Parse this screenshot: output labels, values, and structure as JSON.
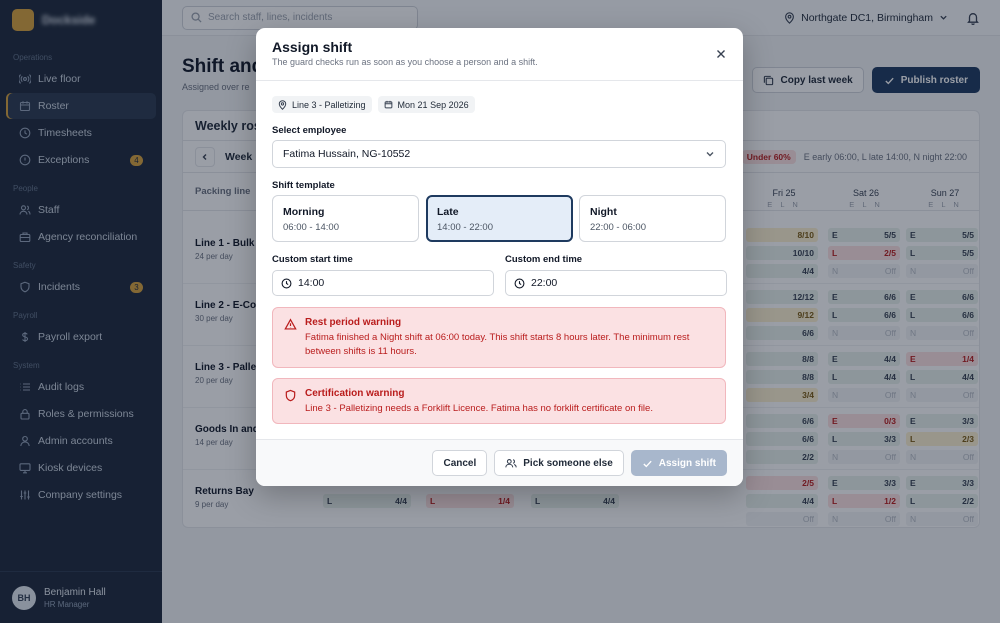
{
  "app": {
    "brand": "Dockside"
  },
  "sidebar": {
    "sections": [
      {
        "title": "Operations",
        "items": [
          {
            "label": "Live floor",
            "icon": "broadcast-icon"
          },
          {
            "label": "Roster",
            "icon": "calendar-icon",
            "active": true
          },
          {
            "label": "Timesheets",
            "icon": "clock-icon"
          },
          {
            "label": "Exceptions",
            "icon": "alert-circle-icon",
            "badge": "4"
          }
        ]
      },
      {
        "title": "People",
        "items": [
          {
            "label": "Staff",
            "icon": "users-icon"
          },
          {
            "label": "Agency reconciliation",
            "icon": "briefcase-icon"
          }
        ]
      },
      {
        "title": "Safety",
        "items": [
          {
            "label": "Incidents",
            "icon": "shield-icon",
            "badge": "3"
          }
        ]
      },
      {
        "title": "Payroll",
        "items": [
          {
            "label": "Payroll export",
            "icon": "dollar-icon"
          }
        ]
      },
      {
        "title": "System",
        "items": [
          {
            "label": "Audit logs",
            "icon": "list-icon"
          },
          {
            "label": "Roles & permissions",
            "icon": "lock-icon"
          },
          {
            "label": "Admin accounts",
            "icon": "user-icon"
          },
          {
            "label": "Kiosk devices",
            "icon": "monitor-icon"
          },
          {
            "label": "Company settings",
            "icon": "sliders-icon"
          }
        ]
      }
    ],
    "user": {
      "initials": "BH",
      "name": "Benjamin Hall",
      "role": "HR Manager"
    }
  },
  "topbar": {
    "search_placeholder": "Search staff, lines, incidents",
    "location": "Northgate DC1, Birmingham"
  },
  "page": {
    "title": "Shift and",
    "subtitle": "Assigned over re",
    "copy_label": "Copy last week",
    "publish_label": "Publish roster",
    "card_title": "Weekly ros",
    "week_label": "Week",
    "under_badge": "Under 60%",
    "legend_text": "E early 06:00, L late 14:00, N night 22:00",
    "line_header": "Packing line",
    "days": [
      {
        "name": "Fri 25",
        "sub": "E L N"
      },
      {
        "name": "Sat 26",
        "sub": "E L N"
      },
      {
        "name": "Sun 27",
        "sub": "E L N"
      }
    ],
    "lines": [
      {
        "name": "Line 1 - Bulk P",
        "sub": "24 per day",
        "rows": [
          [
            {
              "k": "",
              "v": "8/10",
              "s": "warn"
            },
            {
              "k": "E",
              "v": "5/5",
              "s": "ok"
            },
            {
              "k": "E",
              "v": "5/5",
              "s": "ok"
            }
          ],
          [
            {
              "k": "",
              "v": "10/10",
              "s": "ok"
            },
            {
              "k": "L",
              "v": "2/5",
              "s": "bad"
            },
            {
              "k": "L",
              "v": "5/5",
              "s": "ok"
            }
          ],
          [
            {
              "k": "",
              "v": "4/4",
              "s": "ok"
            },
            {
              "k": "N",
              "v": "Off",
              "s": "off"
            },
            {
              "k": "N",
              "v": "Off",
              "s": "off"
            }
          ]
        ]
      },
      {
        "name": "Line 2 - E-Con",
        "sub": "30 per day",
        "rows": [
          [
            {
              "k": "",
              "v": "12/12",
              "s": "ok"
            },
            {
              "k": "E",
              "v": "6/6",
              "s": "ok"
            },
            {
              "k": "E",
              "v": "6/6",
              "s": "ok"
            }
          ],
          [
            {
              "k": "",
              "v": "9/12",
              "s": "warn"
            },
            {
              "k": "L",
              "v": "6/6",
              "s": "ok"
            },
            {
              "k": "L",
              "v": "6/6",
              "s": "ok"
            }
          ],
          [
            {
              "k": "",
              "v": "6/6",
              "s": "ok"
            },
            {
              "k": "N",
              "v": "Off",
              "s": "off"
            },
            {
              "k": "N",
              "v": "Off",
              "s": "off"
            }
          ]
        ]
      },
      {
        "name": "Line 3 - Pallet",
        "sub": "20 per day",
        "rows": [
          [
            {
              "k": "",
              "v": "8/8",
              "s": "ok"
            },
            {
              "k": "E",
              "v": "4/4",
              "s": "ok"
            },
            {
              "k": "E",
              "v": "1/4",
              "s": "bad"
            }
          ],
          [
            {
              "k": "",
              "v": "8/8",
              "s": "ok"
            },
            {
              "k": "L",
              "v": "4/4",
              "s": "ok"
            },
            {
              "k": "L",
              "v": "4/4",
              "s": "ok"
            }
          ],
          [
            {
              "k": "",
              "v": "3/4",
              "s": "warn"
            },
            {
              "k": "N",
              "v": "Off",
              "s": "off"
            },
            {
              "k": "N",
              "v": "Off",
              "s": "off"
            }
          ]
        ]
      },
      {
        "name": "Goods In and",
        "sub": "14 per day",
        "rows": [
          [
            {
              "k": "",
              "v": "6/6",
              "s": "ok"
            },
            {
              "k": "E",
              "v": "0/3",
              "s": "bad"
            },
            {
              "k": "E",
              "v": "3/3",
              "s": "ok"
            }
          ],
          [
            {
              "k": "",
              "v": "6/6",
              "s": "ok"
            },
            {
              "k": "L",
              "v": "3/3",
              "s": "ok"
            },
            {
              "k": "L",
              "v": "2/3",
              "s": "warn"
            }
          ],
          [
            {
              "k": "",
              "v": "2/2",
              "s": "ok"
            },
            {
              "k": "N",
              "v": "Off",
              "s": "off"
            },
            {
              "k": "N",
              "v": "Off",
              "s": "off"
            }
          ]
        ]
      },
      {
        "name": "Returns Bay",
        "sub": "9 per day",
        "rows": [
          [
            {
              "k": "",
              "v": "2/5",
              "s": "bad"
            },
            {
              "k": "E",
              "v": "3/3",
              "s": "ok"
            },
            {
              "k": "E",
              "v": "3/3",
              "s": "ok"
            }
          ],
          [
            {
              "k": "",
              "v": "4/4",
              "s": "ok"
            },
            {
              "k": "L",
              "v": "1/2",
              "s": "bad"
            },
            {
              "k": "L",
              "v": "2/2",
              "s": "ok"
            }
          ],
          [
            {
              "k": "",
              "v": "Off",
              "s": "off"
            },
            {
              "k": "N",
              "v": "Off",
              "s": "off"
            },
            {
              "k": "N",
              "v": "Off",
              "s": "off"
            }
          ]
        ]
      }
    ],
    "returns_extra": [
      {
        "k": "L",
        "v": "4/4",
        "s": "ok"
      },
      {
        "k": "L",
        "v": "1/4",
        "s": "bad"
      },
      {
        "k": "L",
        "v": "4/4",
        "s": "ok"
      }
    ]
  },
  "modal": {
    "title": "Assign shift",
    "subtitle": "The guard checks run as soon as you choose a person and a shift.",
    "chip_location": "Line 3 - Palletizing",
    "chip_date": "Mon 21 Sep 2026",
    "employee_label": "Select employee",
    "employee_value": "Fatima Hussain, NG-10552",
    "template_label": "Shift template",
    "templates": [
      {
        "name": "Morning",
        "time": "06:00 - 14:00"
      },
      {
        "name": "Late",
        "time": "14:00 - 22:00",
        "selected": true
      },
      {
        "name": "Night",
        "time": "22:00 - 06:00"
      }
    ],
    "start_label": "Custom start time",
    "start_value": "14:00",
    "end_label": "Custom end time",
    "end_value": "22:00",
    "warning_rest_title": "Rest period warning",
    "warning_rest_body": "Fatima finished a Night shift at 06:00 today. This shift starts 8 hours later. The minimum rest between shifts is 11 hours.",
    "warning_cert_title": "Certification warning",
    "warning_cert_body": "Line 3 - Palletizing needs a Forklift Licence. Fatima has no forklift certificate on file.",
    "cancel_label": "Cancel",
    "pick_label": "Pick someone else",
    "assign_label": "Assign shift"
  },
  "colors": {
    "accent": "#1e3a5f",
    "brand": "#d8a23c",
    "danger": "#b91c1c"
  }
}
